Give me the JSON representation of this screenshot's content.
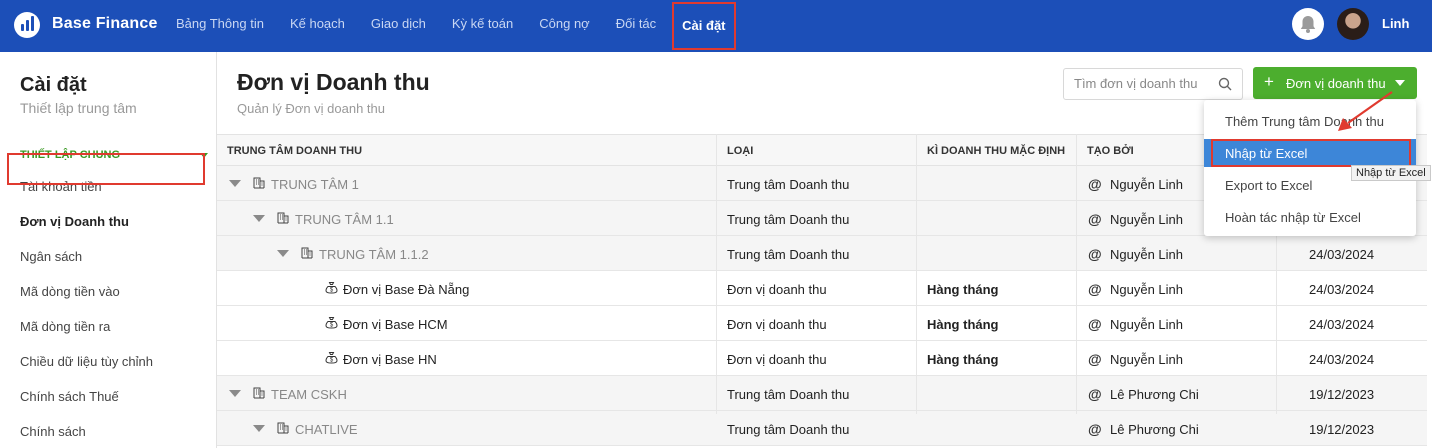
{
  "app": {
    "brand": "Base Finance",
    "user_name": "Linh"
  },
  "nav": {
    "items": [
      "Bảng Thông tin",
      "Kế hoạch",
      "Giao dịch",
      "Kỳ kế toán",
      "Công nợ",
      "Đối tác",
      "Cài đặt"
    ],
    "active": "Cài đặt"
  },
  "sidebar": {
    "title": "Cài đặt",
    "subtitle": "Thiết lập trung tâm",
    "section": "THIẾT LẬP CHUNG",
    "items": [
      "Tài khoản tiền",
      "Đơn vị Doanh thu",
      "Ngân sách",
      "Mã dòng tiền vào",
      "Mã dòng tiền ra",
      "Chiều dữ liệu tùy chỉnh",
      "Chính sách Thuế",
      "Chính sách"
    ],
    "active": "Đơn vị Doanh thu"
  },
  "page": {
    "title": "Đơn vị Doanh thu",
    "subtitle": "Quản lý Đơn vị doanh thu",
    "search_placeholder": "Tìm đơn vị doanh thu",
    "add_button": "Đơn vị doanh thu"
  },
  "table": {
    "headers": [
      "TRUNG TÂM DOANH THU",
      "LOẠI",
      "KÌ DOANH THU MẶC ĐỊNH",
      "TẠO BỞI"
    ],
    "rows": [
      {
        "name": "TRUNG TÂM 1",
        "type": "Trung tâm Doanh thu",
        "period": "",
        "created_by": "Nguyễn Linh",
        "date": ""
      },
      {
        "name": "TRUNG TÂM 1.1",
        "type": "Trung tâm Doanh thu",
        "period": "",
        "created_by": "Nguyễn Linh",
        "date": ""
      },
      {
        "name": "TRUNG TÂM 1.1.2",
        "type": "Trung tâm Doanh thu",
        "period": "",
        "created_by": "Nguyễn Linh",
        "date": "24/03/2024"
      },
      {
        "name": "Đơn vị Base Đà Nẵng",
        "type": "Đơn vị doanh thu",
        "period": "Hàng tháng",
        "created_by": "Nguyễn Linh",
        "date": "24/03/2024"
      },
      {
        "name": "Đơn vị Base HCM",
        "type": "Đơn vị doanh thu",
        "period": "Hàng tháng",
        "created_by": "Nguyễn Linh",
        "date": "24/03/2024"
      },
      {
        "name": "Đơn vị Base HN",
        "type": "Đơn vị doanh thu",
        "period": "Hàng tháng",
        "created_by": "Nguyễn Linh",
        "date": "24/03/2024"
      },
      {
        "name": "TEAM CSKH",
        "type": "Trung tâm Doanh thu",
        "period": "",
        "created_by": "Lê Phương Chi",
        "date": "19/12/2023"
      },
      {
        "name": "CHATLIVE",
        "type": "Trung tâm Doanh thu",
        "period": "",
        "created_by": "Lê Phương Chi",
        "date": "19/12/2023"
      }
    ]
  },
  "dropdown": {
    "items": [
      "Thêm Trung tâm Doanh thu",
      "Nhập từ Excel",
      "Export to Excel",
      "Hoàn tác nhập từ Excel"
    ],
    "highlighted": "Nhập từ Excel",
    "tooltip": "Nhập từ Excel"
  },
  "colors": {
    "topbar": "#1c4fb8",
    "accent_green": "#4cae2e",
    "highlight_blue": "#3d86d8",
    "annotation_red": "#e03a2f"
  },
  "icons": [
    "logo-icon",
    "bell-icon",
    "search-icon",
    "plus-icon",
    "caret-down-icon",
    "building-icon",
    "coin-bag-icon",
    "at-icon"
  ]
}
